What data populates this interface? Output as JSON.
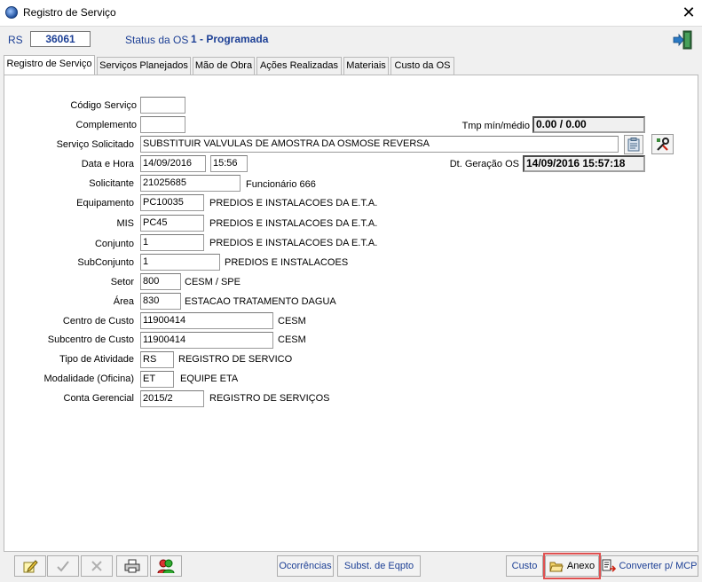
{
  "window": {
    "title": "Registro de Serviço",
    "close_glyph": "✕"
  },
  "header": {
    "rs_label": "RS",
    "rs_number": "36061",
    "status_label": "Status da OS",
    "status_value": "1 - Programada"
  },
  "tabs": [
    {
      "label": "Registro de Serviço"
    },
    {
      "label": "Serviços Planejados"
    },
    {
      "label": "Mão de Obra"
    },
    {
      "label": "Ações Realizadas"
    },
    {
      "label": "Materiais"
    },
    {
      "label": "Custo da OS"
    }
  ],
  "form": {
    "codigo_servico": {
      "label": "Código Serviço",
      "value": ""
    },
    "complemento": {
      "label": "Complemento",
      "value": ""
    },
    "tmp": {
      "label": "Tmp mín/médio",
      "value": "0.00 / 0.00"
    },
    "servico_solicitado": {
      "label": "Serviço Solicitado",
      "value": "SUBSTITUIR VALVULAS DE AMOSTRA DA OSMOSE REVERSA"
    },
    "data_hora": {
      "label": "Data e Hora",
      "date": "14/09/2016",
      "time": "15:56"
    },
    "dt_geracao": {
      "label": "Dt. Geração OS",
      "value": "14/09/2016 15:57:18"
    },
    "solicitante": {
      "label": "Solicitante",
      "value": "21025685",
      "desc": "Funcionário 666"
    },
    "equipamento": {
      "label": "Equipamento",
      "value": "PC10035",
      "desc": "PREDIOS E INSTALACOES DA E.T.A."
    },
    "mis": {
      "label": "MIS",
      "value": "PC45",
      "desc": "PREDIOS E INSTALACOES DA E.T.A."
    },
    "conjunto": {
      "label": "Conjunto",
      "value": "1",
      "desc": "PREDIOS E INSTALACOES DA E.T.A."
    },
    "subconjunto": {
      "label": "SubConjunto",
      "value": "1",
      "desc": "PREDIOS E INSTALACOES"
    },
    "setor": {
      "label": "Setor",
      "value": "800",
      "desc": "CESM / SPE"
    },
    "area": {
      "label": "Área",
      "value": "830",
      "desc": "ESTACAO TRATAMENTO DAGUA"
    },
    "centro_custo": {
      "label": "Centro de Custo",
      "value": "11900414",
      "desc": "CESM"
    },
    "subcentro_custo": {
      "label": "Subcentro de Custo",
      "value": "11900414",
      "desc": "CESM"
    },
    "tipo_atividade": {
      "label": "Tipo de Atividade",
      "value": "RS",
      "desc": "REGISTRO DE SERVICO"
    },
    "modalidade": {
      "label": "Modalidade (Oficina)",
      "value": "ET",
      "desc": "EQUIPE ETA"
    },
    "conta_gerencial": {
      "label": "Conta Gerencial",
      "value": "2015/2",
      "desc": "REGISTRO DE SERVIÇOS"
    }
  },
  "toolbar": {
    "ocorrencias": "Ocorrências",
    "subst_eqpto": "Subst. de Eqpto",
    "custo": "Custo",
    "anexo": "Anexo",
    "converter": "Converter p/ MCP"
  },
  "colors": {
    "accent_blue": "#1c3f95",
    "highlight_red": "#e05050"
  }
}
